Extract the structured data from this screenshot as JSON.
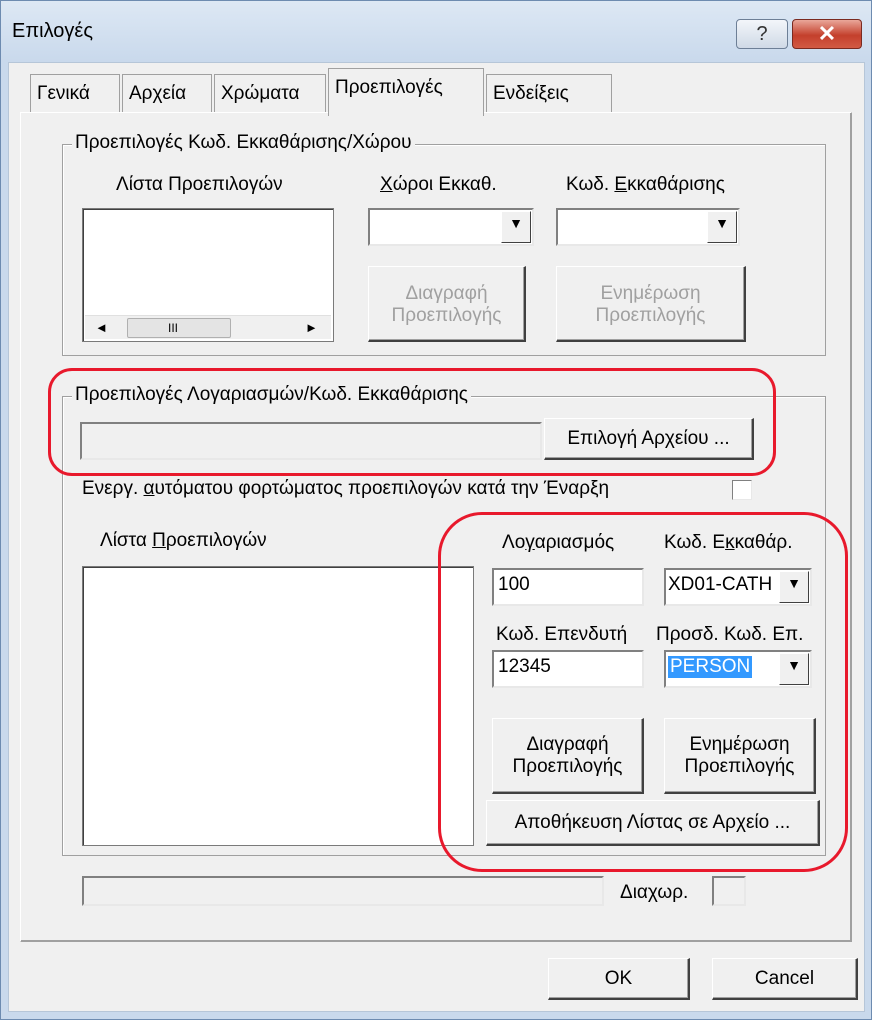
{
  "window": {
    "title": "Επιλογές",
    "help_glyph": "?",
    "close_glyph": "✕"
  },
  "tabs": [
    {
      "label": "Γενικά"
    },
    {
      "label": "Αρχεία"
    },
    {
      "label": "Χρώματα"
    },
    {
      "label": "Προεπιλογές"
    },
    {
      "label": "Ενδείξεις"
    }
  ],
  "active_tab": "Προεπιλογές",
  "group_clearing_space": {
    "title": "Προεπιλογές Κωδ. Εκκαθάρισης/Χώρου",
    "list_label": "Λίστα Προεπιλογών",
    "spaces_label_mnemonic": "Χ",
    "spaces_label_rest": "ώροι Εκκαθ.",
    "code_label_prefix": "Κωδ. ",
    "code_label_mnemonic": "Ε",
    "code_label_rest": "κκαθάρισης",
    "spaces_value": "",
    "code_value": "",
    "delete_button": [
      "Διαγραφή",
      "Προεπιλογής"
    ],
    "update_button": [
      "Ενημέρωση",
      "Προεπιλογής"
    ],
    "scroll_left": "◄",
    "scroll_thumb": "III",
    "scroll_right": "►"
  },
  "group_accounts": {
    "title": "Προεπιλογές Λογαριασμών/Κωδ. Εκκαθάρισης",
    "file_path": "",
    "select_file_button": "Επιλογή Αρχείου ...",
    "autoload_prefix": "Ενεργ. ",
    "autoload_mnemonic": "α",
    "autoload_rest": "υτόματου φορτώματος προεπιλογών κατά την Έναρξη",
    "autoload_checked": false,
    "list_label_prefix": "Λίστα ",
    "list_label_mnemonic": "Π",
    "list_label_rest": "ροεπιλογών",
    "account_label_prefix": "Λο",
    "account_label_mnemonic": "γ",
    "account_label_rest": "αριασμός",
    "account_value": "100",
    "clearing_label_prefix": "Κωδ. Ε",
    "clearing_label_mnemonic": "κ",
    "clearing_label_rest": "καθάρ.",
    "clearing_value": "XD01-CATH",
    "investor_label": "Κωδ. Επενδυτή",
    "investor_value": "12345",
    "investor_type_label": "Προσδ. Κωδ. Επ.",
    "investor_type_value": "PERSON",
    "delete_button": [
      "Διαγραφή",
      "Προεπιλογής"
    ],
    "update_button": [
      "Ενημέρωση",
      "Προεπιλογής"
    ],
    "save_list_button": "Αποθήκευση Λίστας σε Αρχείο ..."
  },
  "status": {
    "separator_label": "Διαχωρ.",
    "separator_value": ""
  },
  "footer": {
    "ok_label": "OK",
    "cancel_label": "Cancel"
  },
  "icons": {
    "dropdown": "▼"
  }
}
